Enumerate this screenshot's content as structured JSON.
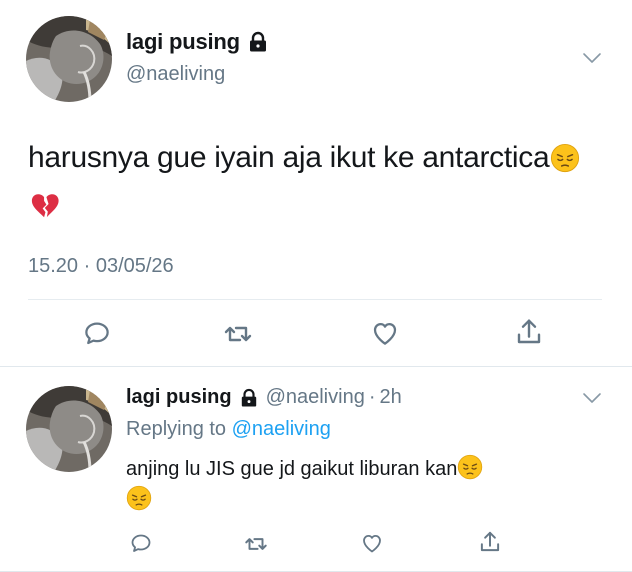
{
  "main_tweet": {
    "display_name": "lagi pusing",
    "handle": "@naeliving",
    "text": "harusnya gue iyain aja ikut ke antarctica",
    "emojis": [
      "pensive-face-emoji",
      "broken-heart-emoji"
    ],
    "timestamp": "15.20 · 03/05/26",
    "actions": [
      "reply-icon",
      "retweet-icon",
      "like-icon",
      "share-icon"
    ]
  },
  "reply_tweet": {
    "display_name": "lagi pusing",
    "handle": "@naeliving",
    "dot": "·",
    "time": "2h",
    "replying_prefix": "Replying to",
    "replying_user": "@naeliving",
    "text": "anjing lu JIS gue jd gaikut liburan kan",
    "emojis": [
      "pensive-face-emoji",
      "pensive-face-emoji"
    ],
    "actions": [
      "reply-icon",
      "retweet-icon",
      "like-icon",
      "share-icon"
    ]
  },
  "colors": {
    "text": "#14171a",
    "secondary": "#657786",
    "link": "#1da1f2",
    "divider": "#e1e8ed"
  }
}
